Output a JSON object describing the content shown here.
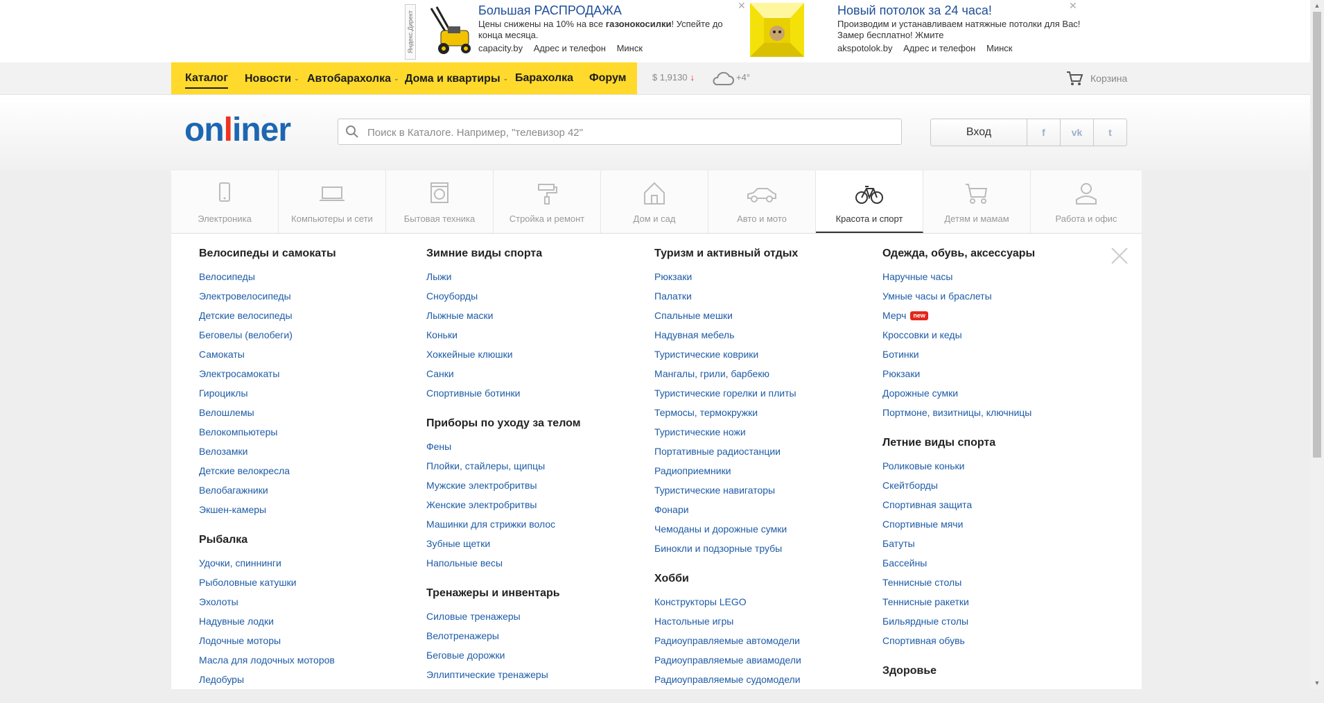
{
  "ads": [
    {
      "vertical_label": "Яндекс.Директ",
      "image": "lawn-mower-image",
      "title": "Большая РАСПРОДАЖА",
      "description_pre": "Цены снижены на 10% на все ",
      "description_bold": "газонокосилки",
      "description_post": "! Успейте до конца месяца.",
      "domain": "capacity.by",
      "contacts": "Адрес и телефон",
      "city": "Минск",
      "close": "✕"
    },
    {
      "image": "ceiling-image",
      "title": "Новый потолок за 24 часа!",
      "description": "Производим и устанавливаем натяжные потолки для Вас! Замер бесплатно! Жмите",
      "domain": "akspotolok.by",
      "contacts": "Адрес и телефон",
      "city": "Минск",
      "close": "✕"
    }
  ],
  "topnav": {
    "items": [
      {
        "label": "Каталог",
        "has_dropdown": false,
        "active": true
      },
      {
        "label": "Новости",
        "has_dropdown": true
      },
      {
        "label": "Автобарахолка",
        "has_dropdown": true
      },
      {
        "label": "Дома и квартиры",
        "has_dropdown": true
      },
      {
        "label": "Барахолка",
        "has_dropdown": false
      },
      {
        "label": "Форум",
        "has_dropdown": false
      }
    ],
    "chevron": "⌄",
    "accent_color": "#ffda2c"
  },
  "currency": {
    "rate": "$ 1,9130",
    "trend": "↓"
  },
  "weather": {
    "icon": "cloud-icon",
    "temperature": "+4°"
  },
  "cart": {
    "icon": "cart-icon",
    "label": "Корзина"
  },
  "header": {
    "logo_part1": "on",
    "logo_part2": "l",
    "logo_part3": "iner",
    "search_placeholder": "Поиск в Каталоге. Например, \"телевизор 42\"",
    "login_label": "Вход",
    "social": [
      "f",
      "vk",
      "t"
    ]
  },
  "catalog_tabs": [
    {
      "label": "Электроника",
      "icon": "phone-icon"
    },
    {
      "label": "Компьютеры и сети",
      "icon": "laptop-icon"
    },
    {
      "label": "Бытовая техника",
      "icon": "washer-icon"
    },
    {
      "label": "Стройка и ремонт",
      "icon": "paint-roller-icon"
    },
    {
      "label": "Дом и сад",
      "icon": "house-icon"
    },
    {
      "label": "Авто и мото",
      "icon": "car-icon"
    },
    {
      "label": "Красота и спорт",
      "icon": "bicycle-icon",
      "active": true
    },
    {
      "label": "Детям и мамам",
      "icon": "stroller-icon"
    },
    {
      "label": "Работа и офис",
      "icon": "person-icon"
    }
  ],
  "columns": [
    [
      {
        "title": "Велосипеды и самокаты",
        "links": [
          "Велосипеды",
          "Электровелосипеды",
          "Детские велосипеды",
          "Беговелы (велобеги)",
          "Самокаты",
          "Электросамокаты",
          "Гироциклы",
          "Велошлемы",
          "Велокомпьютеры",
          "Велозамки",
          "Детские велокресла",
          "Велобагажники",
          "Экшен-камеры"
        ]
      },
      {
        "title": "Рыбалка",
        "links": [
          "Удочки, спиннинги",
          "Рыболовные катушки",
          "Эхолоты",
          "Надувные лодки",
          "Лодочные моторы",
          "Масла для лодочных моторов",
          "Ледобуры"
        ]
      }
    ],
    [
      {
        "title": "Зимние виды спорта",
        "links": [
          "Лыжи",
          "Сноуборды",
          "Лыжные маски",
          "Коньки",
          "Хоккейные клюшки",
          "Санки",
          "Спортивные ботинки"
        ]
      },
      {
        "title": "Приборы по уходу за телом",
        "links": [
          "Фены",
          "Плойки, стайлеры, щипцы",
          "Мужские электробритвы",
          "Женские электробритвы",
          "Машинки для стрижки волос",
          "Зубные щетки",
          "Напольные весы"
        ]
      },
      {
        "title": "Тренажеры и инвентарь",
        "links": [
          "Силовые тренажеры",
          "Велотренажеры",
          "Беговые дорожки",
          "Эллиптические тренажеры"
        ]
      }
    ],
    [
      {
        "title": "Туризм и активный отдых",
        "links": [
          "Рюкзаки",
          "Палатки",
          "Спальные мешки",
          "Надувная мебель",
          "Туристические коврики",
          "Мангалы, грили, барбекю",
          "Туристические горелки и плиты",
          "Термосы, термокружки",
          "Туристические ножи",
          "Портативные радиостанции",
          "Радиоприемники",
          "Туристические навигаторы",
          "Фонари",
          "Чемоданы и дорожные сумки",
          "Бинокли и подзорные трубы"
        ]
      },
      {
        "title": "Хобби",
        "links": [
          "Конструкторы LEGO",
          "Настольные игры",
          "Радиоуправляемые автомодели",
          "Радиоуправляемые авиамодели",
          "Радиоуправляемые судомодели"
        ]
      }
    ],
    [
      {
        "title": "Одежда, обувь, аксессуары",
        "links": [
          "Наручные часы",
          "Умные часы и браслеты",
          "Мерч",
          "Кроссовки и кеды",
          "Ботинки",
          "Рюкзаки",
          "Дорожные сумки",
          "Портмоне, визитницы, ключницы"
        ]
      },
      {
        "title": "Летние виды спорта",
        "links": [
          "Роликовые коньки",
          "Скейтборды",
          "Спортивная защита",
          "Спортивные мячи",
          "Батуты",
          "Бассейны",
          "Теннисные столы",
          "Теннисные ракетки",
          "Бильярдные столы",
          "Спортивная обувь"
        ]
      },
      {
        "title": "Здоровье",
        "links": []
      }
    ]
  ],
  "new_badge": "new",
  "close_icon": "close-icon",
  "scrollbar": {
    "up": "▲",
    "down": "▼"
  }
}
